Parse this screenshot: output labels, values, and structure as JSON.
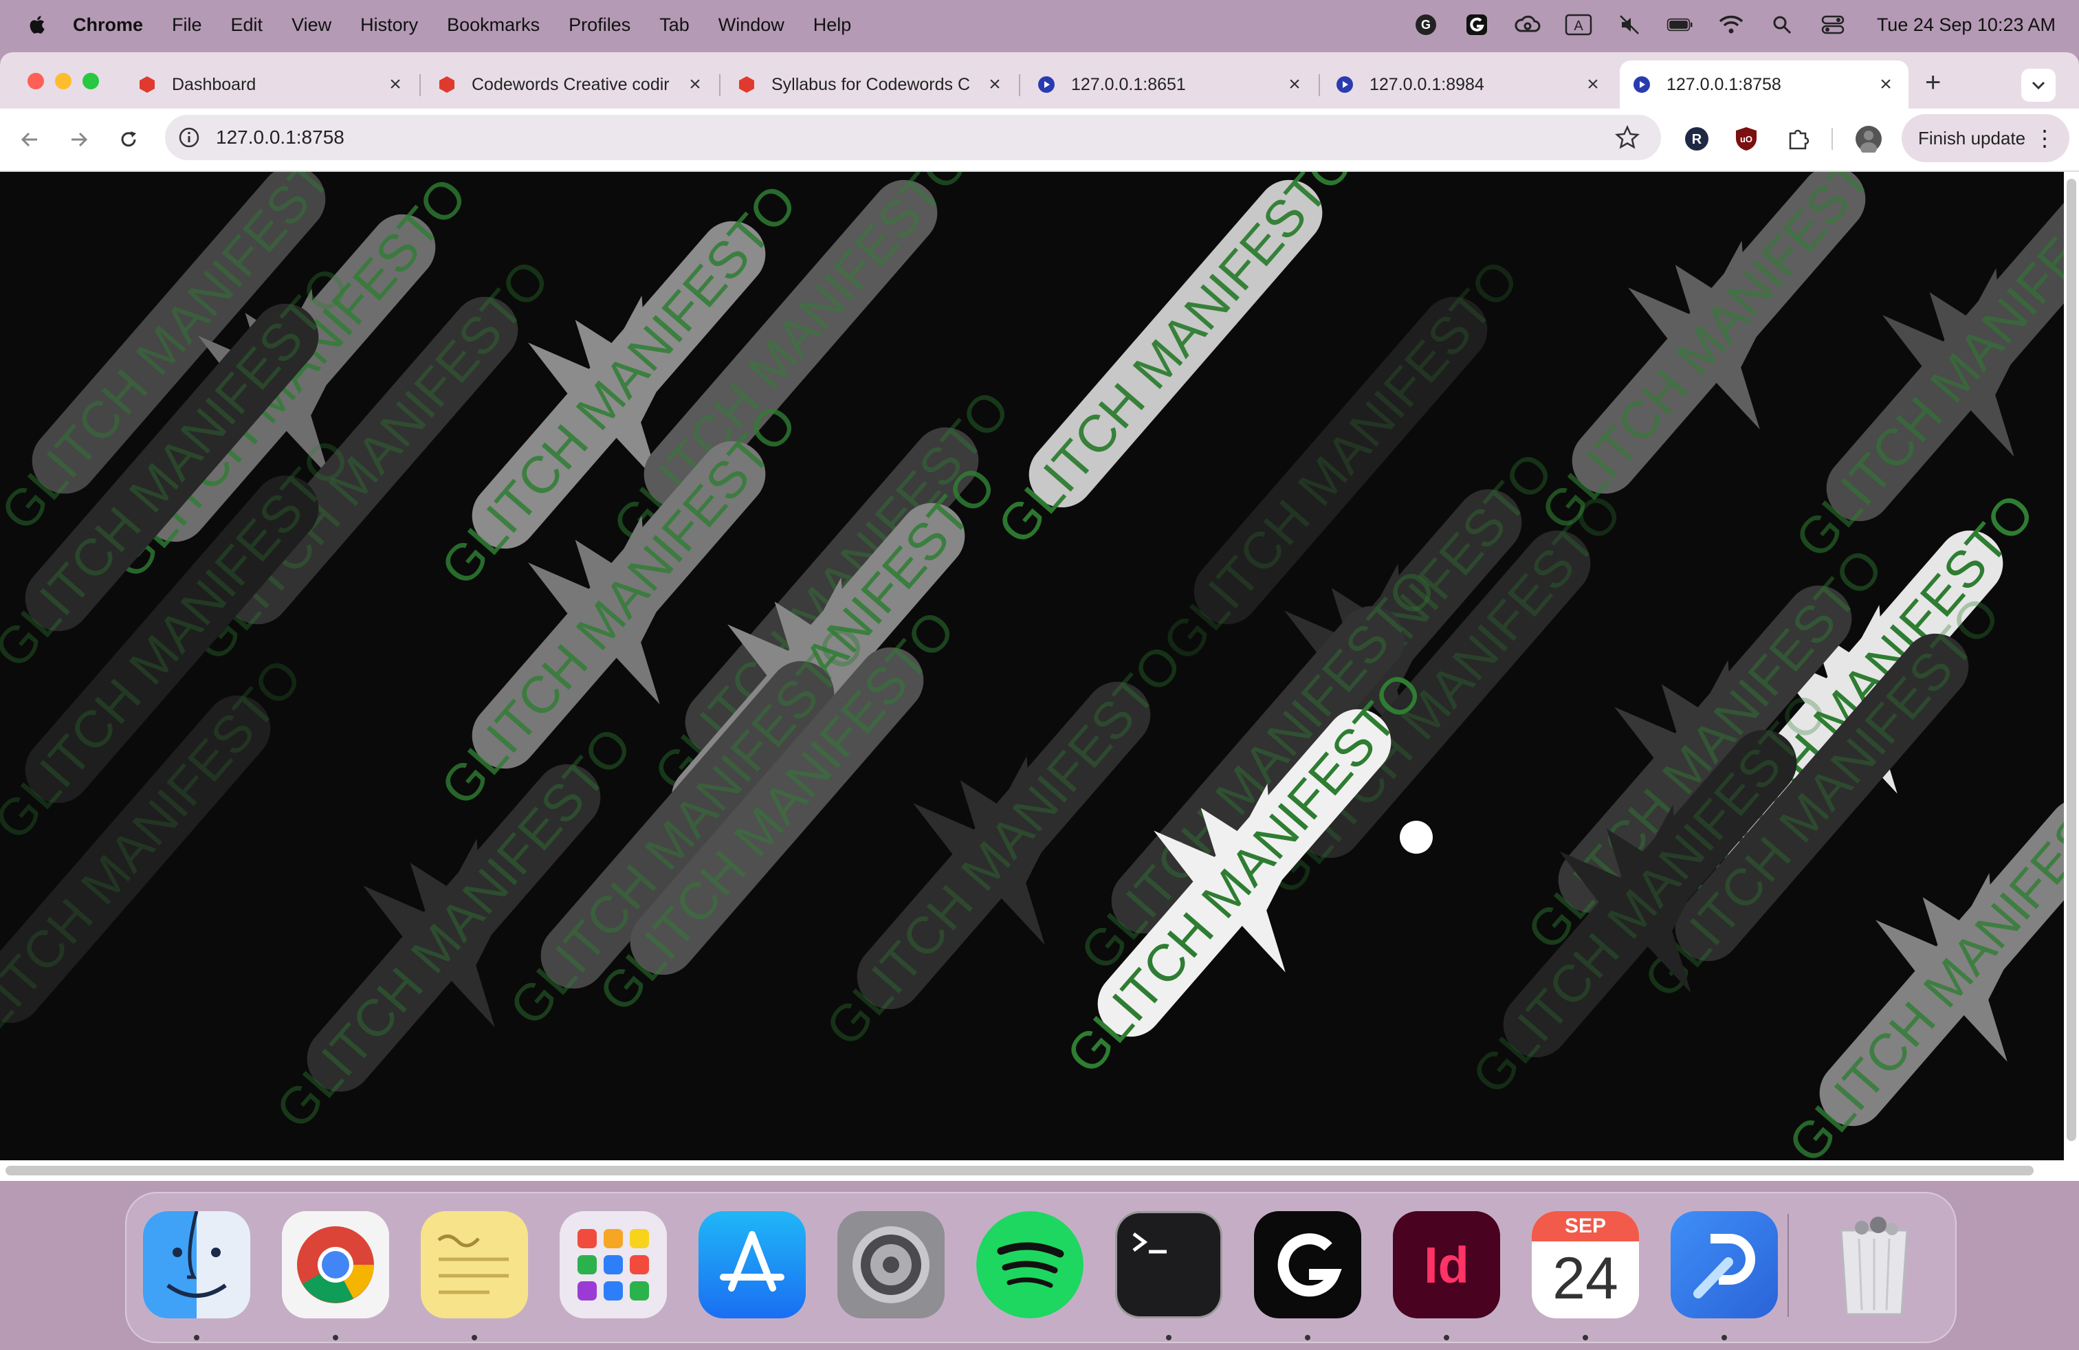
{
  "menubar": {
    "app_name": "Chrome",
    "items": [
      "File",
      "Edit",
      "View",
      "History",
      "Bookmarks",
      "Profiles",
      "Tab",
      "Window",
      "Help"
    ],
    "clock": "Tue 24 Sep  10:23 AM"
  },
  "tabs": [
    {
      "title": "Dashboard",
      "favicon": "red-hexagon-icon"
    },
    {
      "title": "Codewords Creative codir",
      "favicon": "red-hexagon-icon"
    },
    {
      "title": "Syllabus for Codewords C",
      "favicon": "red-hexagon-icon"
    },
    {
      "title": "127.0.0.1:8651",
      "favicon": "blue-circle-icon"
    },
    {
      "title": "127.0.0.1:8984",
      "favicon": "blue-circle-icon"
    },
    {
      "title": "127.0.0.1:8758",
      "favicon": "blue-circle-icon",
      "active": true
    }
  ],
  "toolbar": {
    "url": "127.0.0.1:8758",
    "finish_update_label": "Finish update"
  },
  "canvas": {
    "repeated_text": "GLITCH MANIFESTO",
    "colors": {
      "background": "#0a0a0a",
      "text_green": "#2e7d32",
      "pill_light": "#e8e8e8"
    }
  },
  "dock": {
    "apps": [
      "Finder",
      "Chrome",
      "Stickies",
      "Launchpad",
      "App Store",
      "System Settings",
      "Spotify",
      "Terminal",
      "Logitech G HUB",
      "InDesign",
      "Calendar",
      "Toolbox",
      "Trash"
    ],
    "calendar_month": "SEP",
    "calendar_day": "24"
  }
}
